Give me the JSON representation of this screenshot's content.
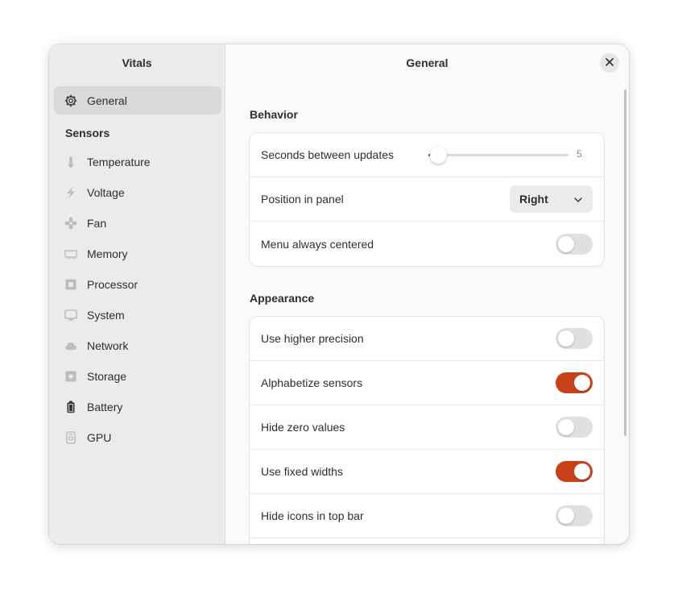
{
  "sidebar": {
    "title": "Vitals",
    "general_label": "General",
    "sensors_heading": "Sensors",
    "items": [
      {
        "label": "Temperature",
        "icon": "thermometer-icon"
      },
      {
        "label": "Voltage",
        "icon": "voltage-icon"
      },
      {
        "label": "Fan",
        "icon": "fan-icon"
      },
      {
        "label": "Memory",
        "icon": "memory-icon"
      },
      {
        "label": "Processor",
        "icon": "processor-icon"
      },
      {
        "label": "System",
        "icon": "monitor-icon"
      },
      {
        "label": "Network",
        "icon": "cloud-icon"
      },
      {
        "label": "Storage",
        "icon": "storage-icon"
      },
      {
        "label": "Battery",
        "icon": "battery-icon"
      },
      {
        "label": "GPU",
        "icon": "gpu-icon"
      }
    ]
  },
  "header": {
    "title": "General"
  },
  "behavior": {
    "title": "Behavior",
    "update_label": "Seconds between updates",
    "update_value": "5",
    "position_label": "Position in panel",
    "position_value": "Right",
    "centered_label": "Menu always centered",
    "centered_on": false
  },
  "appearance": {
    "title": "Appearance",
    "rows": [
      {
        "label": "Use higher precision",
        "on": false
      },
      {
        "label": "Alphabetize sensors",
        "on": true
      },
      {
        "label": "Hide zero values",
        "on": false
      },
      {
        "label": "Use fixed widths",
        "on": true
      },
      {
        "label": "Hide icons in top bar",
        "on": false
      }
    ]
  },
  "colors": {
    "accent": "#c9411a",
    "sidebar_bg": "#ebebeb",
    "toggle_off": "#e0e0e0"
  }
}
